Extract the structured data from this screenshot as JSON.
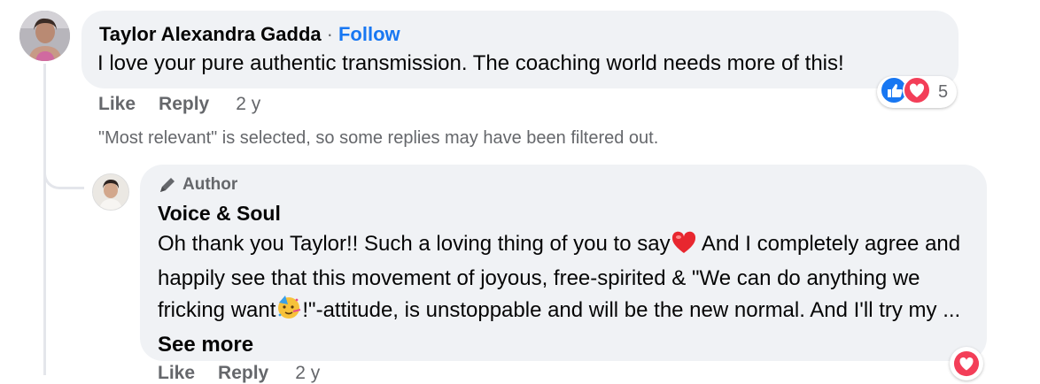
{
  "comment": {
    "author": "Taylor Alexandra Gadda",
    "separator": "·",
    "follow_label": "Follow",
    "text": "I love your pure authentic transmission. The coaching world needs more of this!",
    "actions": {
      "like": "Like",
      "reply": "Reply",
      "age": "2 y"
    },
    "reactions": {
      "icons": [
        "like-icon",
        "love-icon"
      ],
      "count": "5"
    }
  },
  "filter_note": "\"Most relevant\" is selected, so some replies may have been filtered out.",
  "reply": {
    "badge_icon": "pencil-icon",
    "badge_label": "Author",
    "author": "Voice & Soul",
    "text_part1": "Oh thank you Taylor!! Such a loving thing of you to say",
    "text_part2": " And I completely agree and happily see that this movement of joyous, free-spirited & \"We can do anything we fricking want",
    "text_part3": "!\"-attitude, is unstoppable and will be the new normal. And I'll try my ... ",
    "see_more": "See more",
    "actions": {
      "like": "Like",
      "reply": "Reply",
      "age": "2 y"
    },
    "reaction_icon": "love-icon"
  },
  "colors": {
    "link": "#1877f2",
    "bubble": "#f0f2f5",
    "muted": "#65676b",
    "like_blue": "#1877f2",
    "love_red": "#f33e58"
  }
}
